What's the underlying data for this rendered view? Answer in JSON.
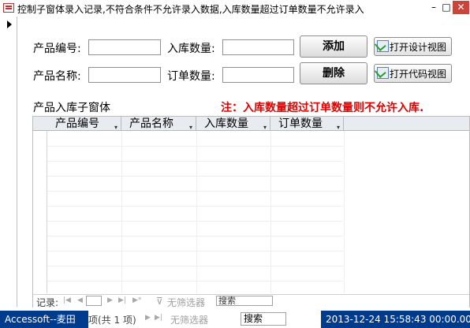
{
  "window": {
    "title": "控制子窗体录入记录,不符合条件不允许录入数据,入库数量超过订单数量不允许录入",
    "min_label": "–",
    "restore_label": "□",
    "close_label": "✕"
  },
  "form": {
    "product_id_label": "产品编号:",
    "product_name_label": "产品名称:",
    "stock_qty_label": "入库数量:",
    "order_qty_label": "订单数量:",
    "add_button": "添加",
    "delete_button": "删除",
    "open_design_button": "打开设计视图",
    "open_code_button": "打开代码视图",
    "subform_label": "产品入库子窗体",
    "note": "注：入库数量超过订单数量则不允许入库."
  },
  "subform": {
    "columns": [
      "产品编号",
      "产品名称",
      "入库数量",
      "订单数量"
    ],
    "nav": {
      "record_label": "记录:",
      "filter_label": "无筛选器",
      "search_label": "搜索"
    }
  },
  "outer_nav": {
    "record_count": "项(共 1 项)",
    "filter_label": "无筛选器",
    "search_label": "搜索"
  },
  "status": {
    "left": "Accessoft--麦田",
    "right": "2013-12-24 15:58:43 00:00.000"
  },
  "colors": {
    "status_bg": "#003b8e",
    "note_red": "#e00000",
    "close_red": "#c9443a"
  }
}
